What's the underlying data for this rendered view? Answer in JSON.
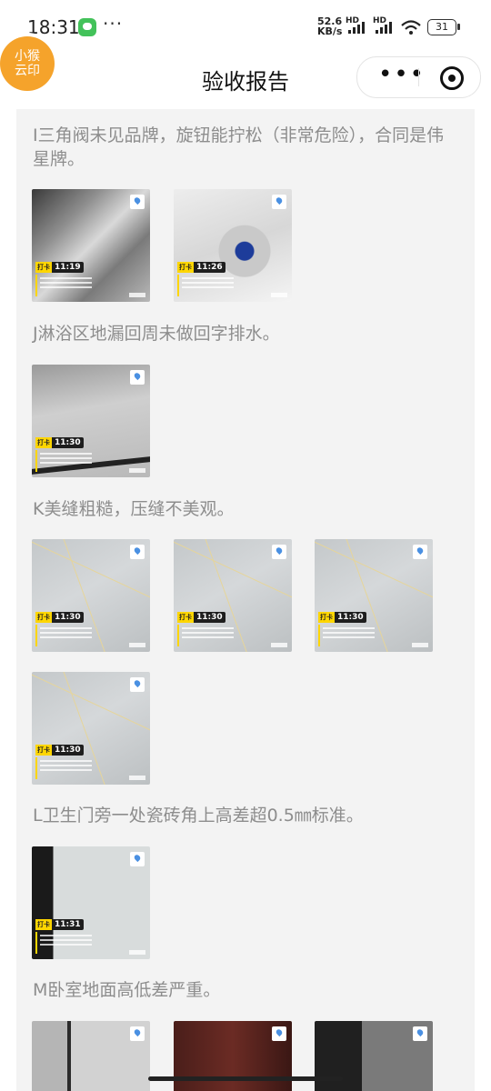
{
  "status_bar": {
    "time": "18:31",
    "net_speed_value": "52.6",
    "net_speed_unit": "KB/s",
    "sim1_label": "HD",
    "sim2_label": "HD",
    "battery": "31"
  },
  "app": {
    "logo_line1": "小猴",
    "logo_line2": "云印",
    "title": "验收报告",
    "more_icon": "more-dots-icon",
    "close_icon": "target-close-icon"
  },
  "sections": [
    {
      "text": "I三角阀未见品牌，旋钮能拧松（非常危险），合同是伟星牌。",
      "photos": [
        {
          "time": "11:19",
          "tag": "打卡"
        },
        {
          "time": "11:26",
          "tag": "打卡"
        }
      ]
    },
    {
      "text": "J淋浴区地漏回周未做回字排水。",
      "photos": [
        {
          "time": "11:30",
          "tag": "打卡"
        }
      ]
    },
    {
      "text": "K美缝粗糙，压缝不美观。",
      "photos": [
        {
          "time": "11:30",
          "tag": "打卡"
        },
        {
          "time": "11:30",
          "tag": "打卡"
        },
        {
          "time": "11:30",
          "tag": "打卡"
        },
        {
          "time": "11:30",
          "tag": "打卡"
        }
      ]
    },
    {
      "text": "L卫生门旁一处瓷砖角上高差超0.5㎜标准。",
      "photos": [
        {
          "time": "11:31",
          "tag": "打卡"
        }
      ]
    },
    {
      "text": "M卧室地面高低差严重。",
      "photos": []
    }
  ]
}
